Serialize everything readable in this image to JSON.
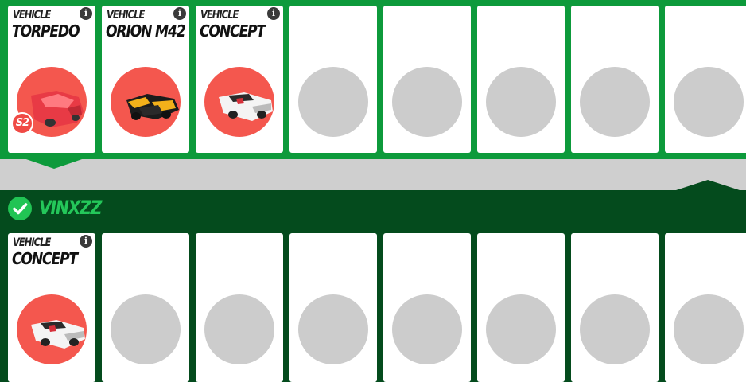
{
  "top_row": {
    "cards": [
      {
        "label": "VEHICLE",
        "name": "TORPEDO",
        "filled": true,
        "badge": "S2",
        "image": "red-torpedo-car"
      },
      {
        "label": "VEHICLE",
        "name": "ORION M42",
        "filled": true,
        "badge": "",
        "image": "yellow-black-orion-car"
      },
      {
        "label": "VEHICLE",
        "name": "CONCEPT",
        "filled": true,
        "badge": "",
        "image": "white-concept-car"
      },
      {
        "label": "",
        "name": "",
        "filled": false
      },
      {
        "label": "",
        "name": "",
        "filled": false
      },
      {
        "label": "",
        "name": "",
        "filled": false
      },
      {
        "label": "",
        "name": "",
        "filled": false
      },
      {
        "label": "",
        "name": "",
        "filled": false
      }
    ]
  },
  "player": {
    "name": "VINXZZ",
    "status_icon": "check-icon",
    "cards": [
      {
        "label": "VEHICLE",
        "name": "CONCEPT",
        "filled": true,
        "badge": "",
        "image": "white-concept-car"
      },
      {
        "label": "",
        "name": "",
        "filled": false
      },
      {
        "label": "",
        "name": "",
        "filled": false
      },
      {
        "label": "",
        "name": "",
        "filled": false
      },
      {
        "label": "",
        "name": "",
        "filled": false
      },
      {
        "label": "",
        "name": "",
        "filled": false
      },
      {
        "label": "",
        "name": "",
        "filled": false
      },
      {
        "label": "",
        "name": "",
        "filled": false
      }
    ]
  },
  "colors": {
    "top_panel": "#0d9a3b",
    "bottom_panel": "#044b1d",
    "player_name": "#24c75a",
    "portrait_filled": "#f4574e",
    "portrait_empty": "#cccccc"
  }
}
